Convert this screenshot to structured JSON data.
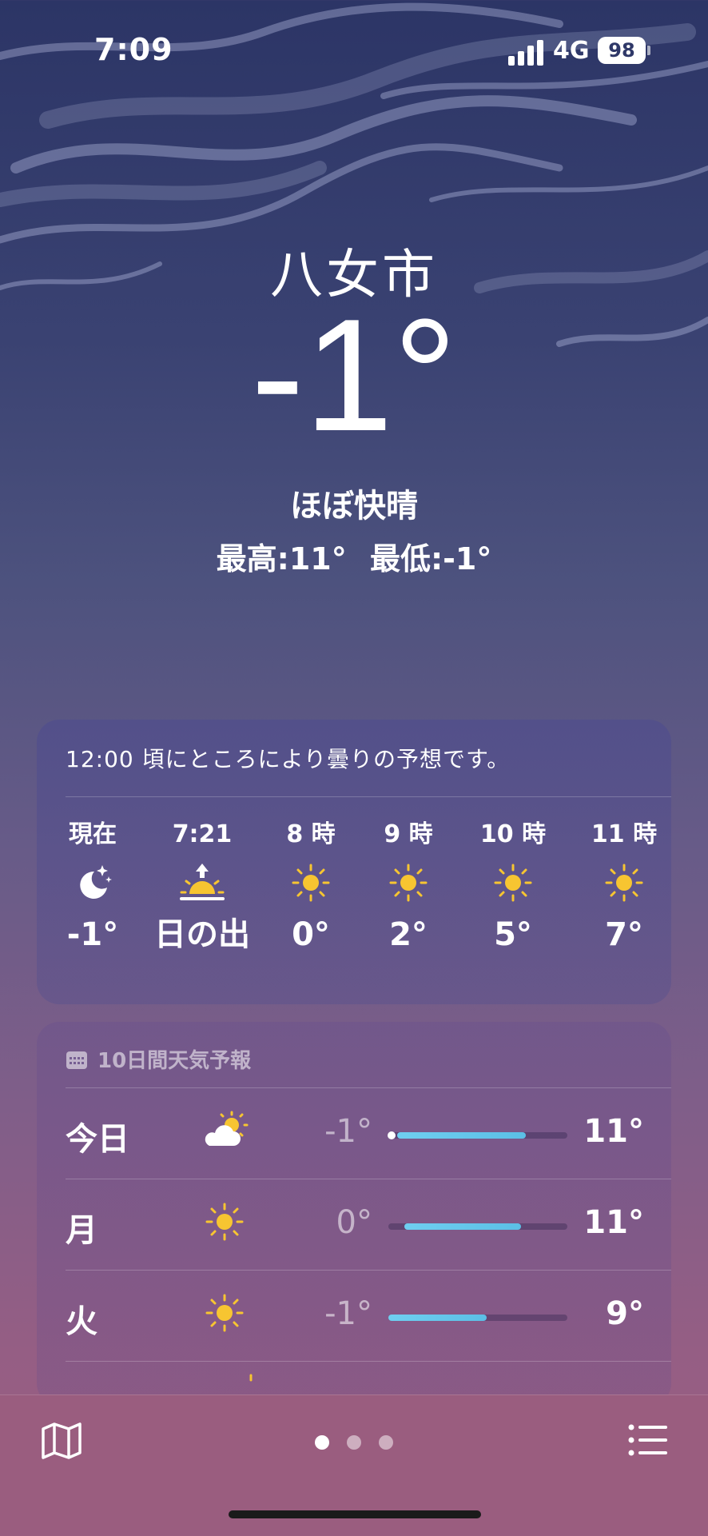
{
  "status_bar": {
    "time": "7:09",
    "network": "4G",
    "battery": "98"
  },
  "location": {
    "city": "八女市",
    "current_temp": "-1°",
    "condition": "ほぼ快晴",
    "high": "最高:11°",
    "low": "最低:-1°"
  },
  "hourly": {
    "summary": "12:00 頃にところにより曇りの予想です。",
    "items": [
      {
        "label": "現在",
        "icon": "moon-stars-icon",
        "value": "-1°"
      },
      {
        "label": "7:21",
        "icon": "sunrise-icon",
        "value": "日の出"
      },
      {
        "label": "8 時",
        "icon": "sun-icon",
        "value": "0°"
      },
      {
        "label": "9 時",
        "icon": "sun-icon",
        "value": "2°"
      },
      {
        "label": "10 時",
        "icon": "sun-icon",
        "value": "5°"
      },
      {
        "label": "11 時",
        "icon": "sun-icon",
        "value": "7°"
      }
    ]
  },
  "daily": {
    "header": "10日間天気予報",
    "days": [
      {
        "day": "今日",
        "icon": "partly-cloudy-sun-icon",
        "low": "-1°",
        "high": "11°",
        "range": [
          0.05,
          0.77
        ],
        "current": 0.02
      },
      {
        "day": "月",
        "icon": "sun-icon",
        "low": "0°",
        "high": "11°",
        "range": [
          0.09,
          0.74
        ]
      },
      {
        "day": "火",
        "icon": "sun-icon",
        "low": "-1°",
        "high": "9°",
        "range": [
          0.0,
          0.55
        ]
      }
    ]
  },
  "bottom_bar": {
    "pages": 3,
    "active_page": 0
  },
  "colors": {
    "sun": "#f7c531",
    "range_bar": "#63c6ec",
    "background_top": "#2c3566",
    "background_bottom": "#9a5d80"
  }
}
